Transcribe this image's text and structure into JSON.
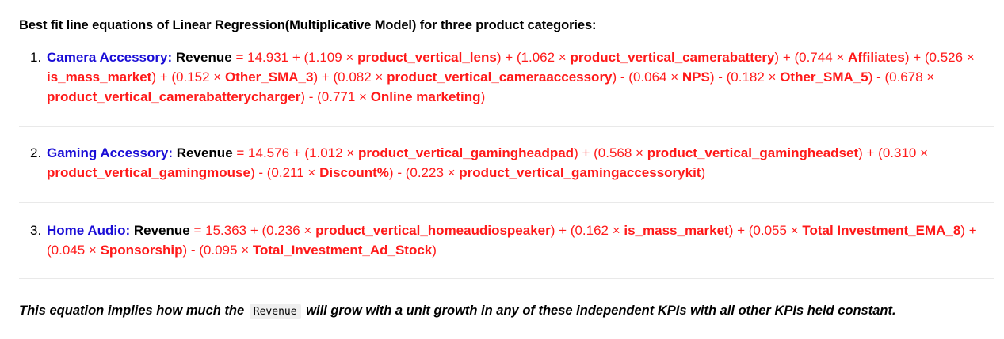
{
  "heading": "Best fit line equations of Linear Regression(Multiplicative Model) for three product categories:",
  "equations": [
    {
      "number": "1.",
      "category": "Camera Accessory:",
      "target": "Revenue",
      "intercept": " = 14.931",
      "terms": [
        {
          "pre": " + (1.109 × ",
          "var": "product_vertical_lens",
          "post": ")"
        },
        {
          "pre": " + (1.062 × ",
          "var": "product_vertical_camerabattery",
          "post": ")"
        },
        {
          "pre": " + (0.744 × ",
          "var": "Affiliates",
          "post": ")"
        },
        {
          "pre": " + (0.526 × ",
          "var": "is_mass_market",
          "post": ")"
        },
        {
          "pre": " + (0.152 × ",
          "var": "Other_SMA_3",
          "post": ")"
        },
        {
          "pre": " + (0.082 × ",
          "var": "product_vertical_cameraaccessory",
          "post": ")"
        },
        {
          "pre": " - (0.064 × ",
          "var": "NPS",
          "post": ")"
        },
        {
          "pre": " - (0.182 × ",
          "var": "Other_SMA_5",
          "post": ")"
        },
        {
          "pre": " - (0.678 × ",
          "var": "product_vertical_camerabatterycharger",
          "post": ")"
        },
        {
          "pre": " - (0.771 × ",
          "var": "Online marketing",
          "post": ")"
        }
      ]
    },
    {
      "number": "2.",
      "category": "Gaming Accessory:",
      "target": "Revenue",
      "intercept": " = 14.576",
      "terms": [
        {
          "pre": " + (1.012 × ",
          "var": "product_vertical_gamingheadpad",
          "post": ")"
        },
        {
          "pre": " + (0.568 × ",
          "var": "product_vertical_gamingheadset",
          "post": ")"
        },
        {
          "pre": " + (0.310 × ",
          "var": "product_vertical_gamingmouse",
          "post": ")"
        },
        {
          "pre": " - (0.211 × ",
          "var": "Discount%",
          "post": ")"
        },
        {
          "pre": " - (0.223 × ",
          "var": "product_vertical_gamingaccessorykit",
          "post": ")"
        }
      ]
    },
    {
      "number": "3.",
      "category": "Home Audio:",
      "target": "Revenue",
      "intercept": " = 15.363",
      "terms": [
        {
          "pre": " + (0.236 × ",
          "var": "product_vertical_homeaudiospeaker",
          "post": ")"
        },
        {
          "pre": " + (0.162 × ",
          "var": "is_mass_market",
          "post": ")"
        },
        {
          "pre": " + (0.055 × ",
          "var": "Total Investment_EMA_8",
          "post": ")"
        },
        {
          "pre": " + (0.045 × ",
          "var": "Sponsorship",
          "post": ")"
        },
        {
          "pre": " - (0.095 × ",
          "var": "Total_Investment_Ad_Stock",
          "post": ")"
        }
      ]
    }
  ],
  "note": {
    "before": "This equation implies how much the ",
    "code": "Revenue",
    "after": " will grow with a unit growth in any of these independent KPIs with all other KPIs held constant."
  },
  "colors": {
    "category": "#1a0dd6",
    "coefficient": "#ff1a1a",
    "separator": "#e9e9e9"
  }
}
